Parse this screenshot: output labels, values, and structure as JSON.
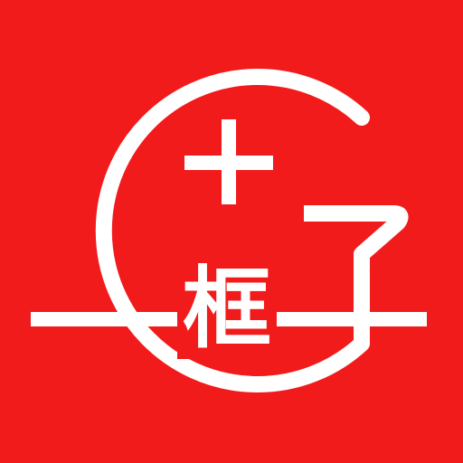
{
  "app_icon": {
    "background_color": "#f21b1b",
    "foreground_color": "#ffffff",
    "center_glyph": "框",
    "icons": {
      "ring": "g-ring-icon",
      "plus": "plus-icon",
      "hook": "hook-icon",
      "baseline": "horizontal-line-icon"
    }
  }
}
